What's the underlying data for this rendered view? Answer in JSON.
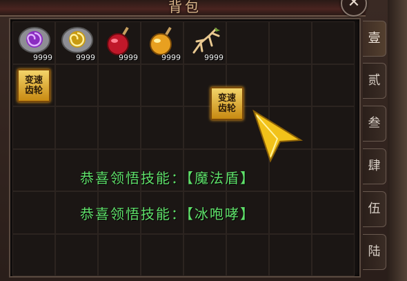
{
  "window": {
    "title": "背包",
    "close_label": "✕"
  },
  "items": [
    {
      "name": "purple-swirl-stone",
      "qty": "9999"
    },
    {
      "name": "gold-swirl-stone",
      "qty": "9999"
    },
    {
      "name": "red-potion",
      "qty": "9999"
    },
    {
      "name": "orange-potion",
      "qty": "9999"
    },
    {
      "name": "ginseng-root",
      "qty": "9999"
    }
  ],
  "gear_item": {
    "line1": "变速",
    "line2": "齿轮"
  },
  "dragged_item": {
    "line1": "变速",
    "line2": "齿轮"
  },
  "messages": [
    "恭喜领悟技能：【魔法盾】",
    "恭喜领悟技能：【冰咆哮】"
  ],
  "tabs": [
    "壹",
    "贰",
    "叁",
    "肆",
    "伍",
    "陆"
  ],
  "colors": {
    "message_green": "#5fe06a",
    "title_gold": "#d9b58a",
    "gear_gold": "#f3d46a"
  }
}
